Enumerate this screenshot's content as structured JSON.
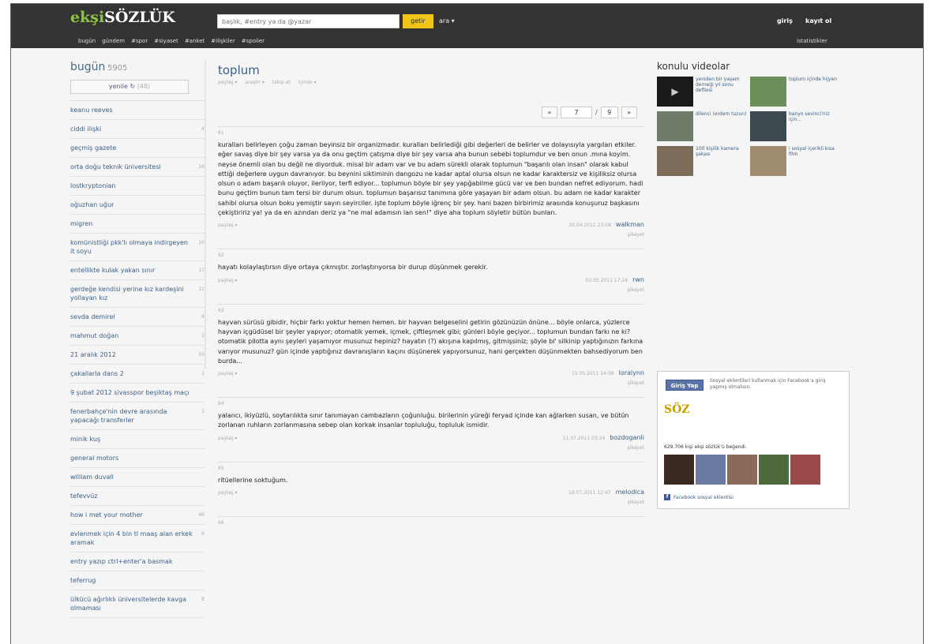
{
  "header": {
    "logo_ek": "ekşi",
    "logo_soz": "SÖZLÜK",
    "search_placeholder": "başlık, #entry ya da @yazar",
    "search_button": "getir",
    "ara": "ara ▾",
    "giris": "giriş",
    "kayit": "kayıt ol",
    "nav": [
      "bugün",
      "gündem",
      "#spor",
      "#siyaset",
      "#anket",
      "#ilişkiler",
      "#spoiler"
    ],
    "istatistikler": "istatistikler"
  },
  "left": {
    "title": "bugün",
    "count": "5905",
    "refresh_label": "yenile ↻",
    "refresh_count": "(48)",
    "topics": [
      {
        "label": "keanu reeves",
        "count": ""
      },
      {
        "label": "ciddi ilişki",
        "count": "4"
      },
      {
        "label": "geçmiş gazete",
        "count": ""
      },
      {
        "label": "orta doğu teknik üniversitesi",
        "count": "16"
      },
      {
        "label": "lostkryptonian",
        "count": ""
      },
      {
        "label": "oğuzhan uğur",
        "count": ""
      },
      {
        "label": "migren",
        "count": ""
      },
      {
        "label": "komünistliği pkk'lı olmaya indirgeyen it soyu",
        "count": "10"
      },
      {
        "label": "entellikte kulak yakan sınır",
        "count": "17"
      },
      {
        "label": "gerdeğe kendisi yerine kız kardeşini yollayan kız",
        "count": "11"
      },
      {
        "label": "sevda demirel",
        "count": "4"
      },
      {
        "label": "mahmut doğan",
        "count": "2"
      },
      {
        "label": "21 aralık 2012",
        "count": "55"
      },
      {
        "label": "çakallarla dans 2",
        "count": "2"
      },
      {
        "label": "9 şubat 2012 sivasspor beşiktaş maçı",
        "count": ""
      },
      {
        "label": "fenerbahçe'nin devre arasında yapacağı transferler",
        "count": "2"
      },
      {
        "label": "minik kuş",
        "count": ""
      },
      {
        "label": "general motors",
        "count": ""
      },
      {
        "label": "william duvall",
        "count": ""
      },
      {
        "label": "tefevvüz",
        "count": ""
      },
      {
        "label": "how i met your mother",
        "count": "46"
      },
      {
        "label": "evlenmek için 4 bin tl maaş alan erkek aramak",
        "count": "6"
      },
      {
        "label": "entry yazıp ctrl+enter'a basmak",
        "count": ""
      },
      {
        "label": "teferrug",
        "count": ""
      },
      {
        "label": "ülkücü ağırlıklı üniversitelerde kavga olmaması",
        "count": "8"
      }
    ]
  },
  "main": {
    "title": "toplum",
    "actions": [
      "paylaş ▾",
      "araştır ▾",
      "takip et",
      "içinde ▾"
    ],
    "pager": {
      "prev": "«",
      "current": "7",
      "sep": "/",
      "total": "9",
      "next": "»"
    },
    "share_label": "paylaş ▾",
    "report_label": "şikayet",
    "entries": [
      {
        "num": "61",
        "text": "kuralları belirleyen çoğu zaman beyinsiz bir organizmadır. kuralları belirlediği gibi değerleri de belirler ve dolayısıyla yargıları etkiler. eğer savaş diye bir şey varsa ya da onu geçtim çatışma diye bir şey varsa aha bunun sebebi toplumdur ve ben onun .mına koyim. neyse önemli olan bu değil ne diyorduk. misal bir adam var ve bu adam sürekli olarak toplumun \"başarılı olan insan\" olarak kabul ettiği değerlere uygun davranıyor. bu beynini siktiminin dangozu ne kadar aptal olursa olsun ne kadar karaktersiz ve kişiliksiz olursa olsun o adam başarılı oluyor, ilerliyor, terfi ediyor... toplumun böyle bir şey yapğabilme gücü var ve ben bundan nefret ediyorum. hadi bunu geçtim bunun tam tersi bir durum olsun. toplumun başarısız tanımına göre yaşayan bir adam olsun. bu adam ne kadar karakter sahibi olursa olsun boku yemiştir sayın seyirciler. işte toplum böyle iğrenç bir şey. hani bazen birbirimiz arasında konuşuruz başkasını çekiştiririz ya! ya da en azından deriz ya \"ne mal adamsın lan sen!\" diye aha toplum söyletir bütün bunları.",
        "date": "20.04.2011 23:08",
        "author": "walkman"
      },
      {
        "num": "62",
        "text": "hayatı kolaylaştırsın diye ortaya çıkmıştır. zorlaştırıyorsa bir durup düşünmek gerekir.",
        "date": "03.05.2011 17:24",
        "author": "rwn"
      },
      {
        "num": "63",
        "text": "hayvan sürüsü gibidir, hiçbir farkı yoktur hemen hemen. bir hayvan belgeselini getirin gözünüzün önüne... böyle onlarca, yüzlerce hayvan içgüdüsel bir şeyler yapıyor; otomatik yemek, içmek, çiftleşmek gibi; günleri böyle geçiyor... toplumun bundan farkı ne ki? otomatik pilotta aynı şeyleri yaşamıyor musunuz hepiniz? hayatın (?) akışına kapılmış, gitmişsiniz; şöyle bi' silkinip yaptığınızın farkına varıyor musunuz? gün içinde yaptığınız davranışların kaçını düşünerek yapıyorsunuz, hani gerçekten düşünmekten bahsediyorum ben burda...",
        "date": "15.05.2011 14:08",
        "author": "loralynn"
      },
      {
        "num": "64",
        "text": "yalancı, ikiyüzlü, soytarılıkta sınır tanımayan cambazların çoğunluğu. birilerinin yüreği feryad içinde kan ağlarken susan, ve bütün zorlanan ruhların zorlanmasına sebep olan korkak insanlar topluluğu, topluluk ismidir.",
        "date": "11.07.2011 03:24",
        "author": "bozdoganli"
      },
      {
        "num": "65",
        "text": "ritüellerine soktuğum.",
        "date": "18.07.2011 12:47",
        "author": "melodica"
      },
      {
        "num": "66",
        "text": "",
        "date": "",
        "author": ""
      }
    ]
  },
  "right": {
    "title": "konulu videolar",
    "videos": [
      {
        "label": "yeniden bir yaşam derneği yıl sonu defilesi",
        "color": "#1a1a1a"
      },
      {
        "label": "toplum içinde hijyen",
        "color": "#6b8f5a"
      },
      {
        "label": "dilenci (erdem tuzun)",
        "color": "#6f7c6a"
      },
      {
        "label": "banyo sevinci'niz için...",
        "color": "#3c4a50"
      },
      {
        "label": "100 kişilik kamera şakası",
        "color": "#7c6c5a"
      },
      {
        "label": "i sosyal içerikli kısa film",
        "color": "#a08c70"
      }
    ],
    "fb": {
      "button": "Giriş Yap",
      "note": "Sosyal eklentileri kullanmak için Facebook'a giriş yapmış olmalısın.",
      "logo": "SÖZ",
      "likes": "629.706 kişi ekşi sözlük'ü beğendi.",
      "footer": "Facebook sosyal eklentisi",
      "faces": [
        "#3a2a22",
        "#6b7aa0",
        "#8a6a5a",
        "#4f6a3a",
        "#9a4a4a"
      ]
    }
  },
  "colors": {
    "accent": "#3b5f86",
    "topbar": "#333333",
    "logo_green": "#8cc63f",
    "search_button": "#f0c419"
  }
}
